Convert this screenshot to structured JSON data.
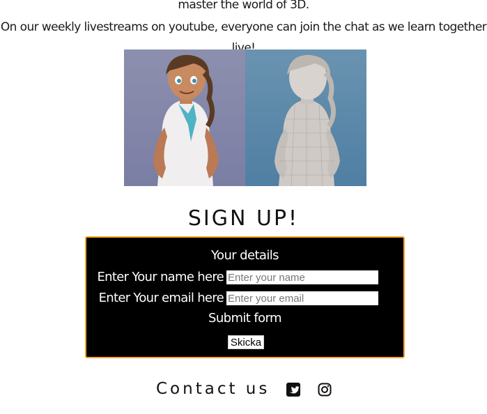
{
  "intro": {
    "line1": "master the world of 3D.",
    "line2": "On our weekly livestreams on youtube, everyone can join the chat as we learn together live!"
  },
  "hero": {
    "icon": "hero-image-3d-character"
  },
  "signup": {
    "title": "SIGN UP!",
    "legend": "Your details",
    "name_label": "Enter Your name here",
    "name_placeholder": "Enter your name",
    "email_label": "Enter Your email here",
    "email_placeholder": "Enter your email",
    "submit_title": "Submit form",
    "button_label": "Skicka",
    "border_color": "#f5a623",
    "background_color": "#000000"
  },
  "contact": {
    "title": "Contact us",
    "icons": [
      "twitter-icon",
      "instagram-icon"
    ]
  }
}
